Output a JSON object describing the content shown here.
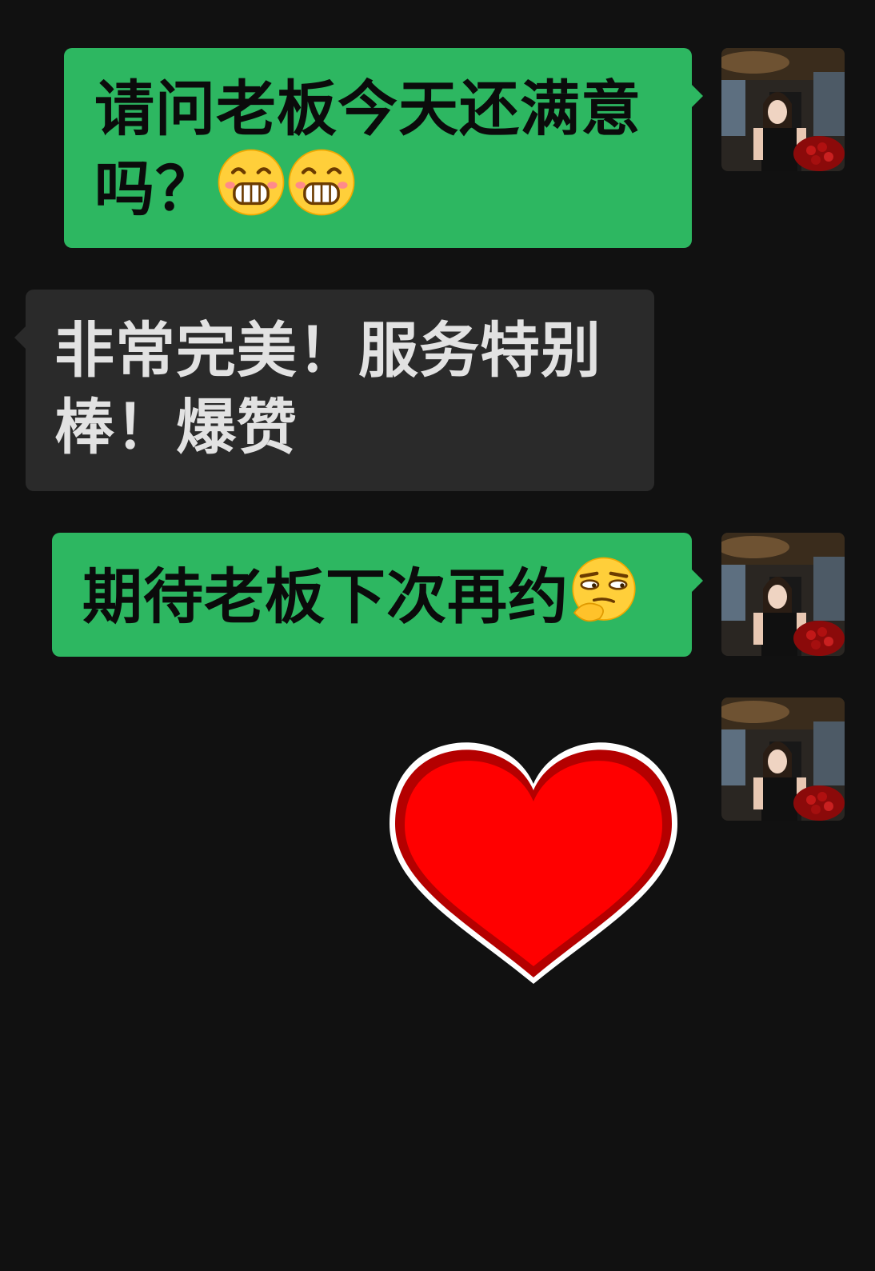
{
  "chat": {
    "background": "#111111",
    "sent_color": "#2db761",
    "received_color": "#2a2a2a",
    "messages": [
      {
        "side": "sent",
        "text": "请问老板今天还满意吗？",
        "emojis": [
          "grinning-face-emoji",
          "grinning-face-emoji"
        ]
      },
      {
        "side": "received",
        "text": "非常完美！服务特别棒！爆赞"
      },
      {
        "side": "sent",
        "text": "期待老板下次再约",
        "emojis": [
          "smirking-thinking-face-emoji"
        ]
      },
      {
        "side": "sent",
        "sticker": "red-heart-sticker",
        "sticker_color": "#ff0000"
      }
    ]
  }
}
